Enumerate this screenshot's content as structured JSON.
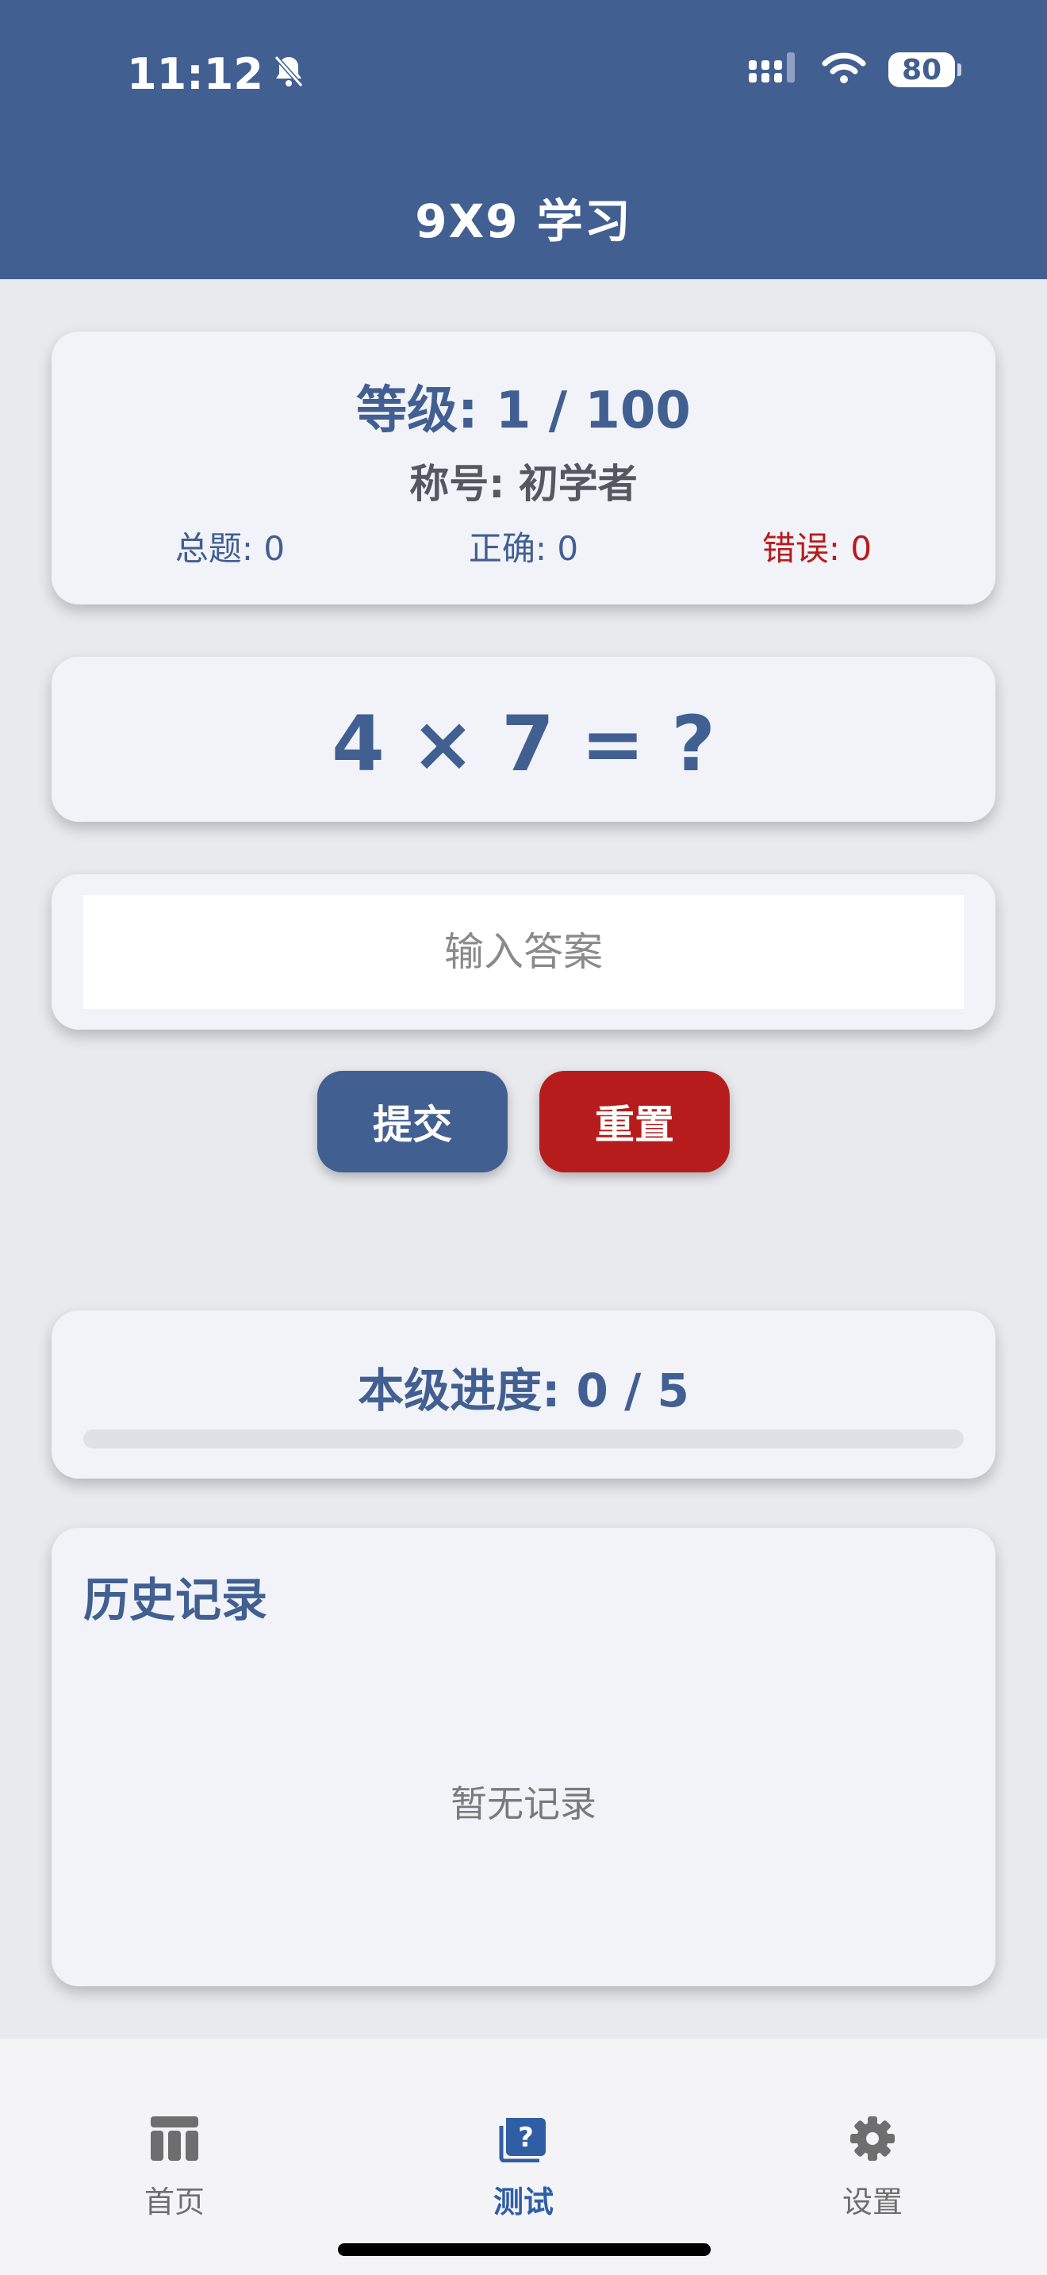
{
  "status_bar": {
    "time": "11:12",
    "battery": "80"
  },
  "header": {
    "title": "9X9 学习"
  },
  "level_card": {
    "level_text": "等级: 1 / 100",
    "rank_text": "称号: 初学者",
    "total_text": "总题: 0",
    "correct_text": "正确: 0",
    "wrong_text": "错误: 0"
  },
  "question": {
    "text": "4 × 7 = ?"
  },
  "answer": {
    "placeholder": "输入答案",
    "value": ""
  },
  "buttons": {
    "submit_label": "提交",
    "reset_label": "重置"
  },
  "progress": {
    "title": "本级进度: 0 / 5",
    "fraction": 0
  },
  "history": {
    "title": "历史记录",
    "empty_text": "暂无记录"
  },
  "tabs": [
    {
      "label": "首页",
      "icon": "home-icon",
      "active": false
    },
    {
      "label": "测试",
      "icon": "quiz-icon",
      "active": true
    },
    {
      "label": "设置",
      "icon": "gear-icon",
      "active": false
    }
  ],
  "colors": {
    "primary": "#415f91",
    "error": "#b71c1c",
    "active_tab": "#2f5ea5"
  }
}
